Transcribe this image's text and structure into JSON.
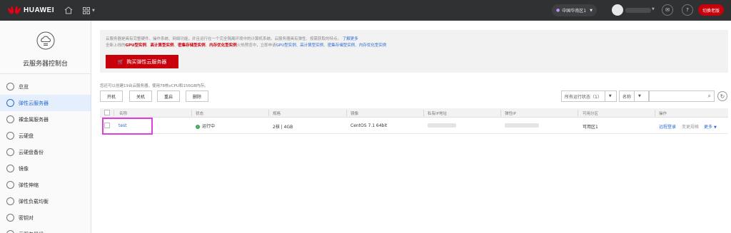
{
  "brand": {
    "name": "HUAWEI",
    "color": "#c7000b"
  },
  "topbar": {
    "region": "中国华南区1",
    "old_version_button": "切换老版"
  },
  "sidebar": {
    "title": "云服务器控制台",
    "items": [
      {
        "label": "总览",
        "icon": "overview-icon"
      },
      {
        "label": "弹性云服务器",
        "icon": "ecs-icon",
        "active": true
      },
      {
        "label": "裸金属服务器",
        "icon": "bms-icon"
      },
      {
        "label": "云硬盘",
        "icon": "disk-icon"
      },
      {
        "label": "云硬盘备份",
        "icon": "backup-icon"
      },
      {
        "label": "镜像",
        "icon": "image-icon"
      },
      {
        "label": "弹性伸缩",
        "icon": "scaling-icon"
      },
      {
        "label": "弹性负载均衡",
        "icon": "elb-icon"
      },
      {
        "label": "密钥对",
        "icon": "key-icon"
      },
      {
        "label": "云服务器组",
        "icon": "group-icon"
      }
    ]
  },
  "notice": {
    "line1": "云服务器是具有完整硬件、操作系统、网络功能，并且运行在一个完全隔离环境中的计算机系统。云服务器具有弹性、按需获取的特点。",
    "line1_link": "了解更多",
    "line2_prefix": "全新上线的",
    "line2_red1": "GPU型实例",
    "line2_red2": "高计算型实例",
    "line2_red3": "密集存储型实例",
    "line2_red4": "内存优化型实例",
    "line2_mid": "火热预览中，立即申请",
    "line2_link1": "GPU型实例",
    "line2_link2": "高计算型实例",
    "line2_link3": "密集存储型实例",
    "line2_link4": "内存优化型实例",
    "buy_button": "购买弹性云服务器"
  },
  "quota_text": "您还可以创建19台云服务器，使用78核vCPU和156GB内存。",
  "actions": {
    "start": "开机",
    "stop": "关机",
    "restart": "重启",
    "delete": "删除"
  },
  "filters": {
    "status": "所有运行状态（1）",
    "name": "名称"
  },
  "table": {
    "headers": [
      "名称",
      "状态",
      "规格",
      "镜像",
      "私有IP地址",
      "弹性IP",
      "可用分区",
      "操作"
    ],
    "rows": [
      {
        "name": "test",
        "status": "运行中",
        "spec": "2核 | 4GB",
        "image": "CentOS 7.1 64bit",
        "zone": "可用区1",
        "op_remote": "远程登录",
        "op_change": "变更规格",
        "op_more": "更多"
      }
    ]
  }
}
